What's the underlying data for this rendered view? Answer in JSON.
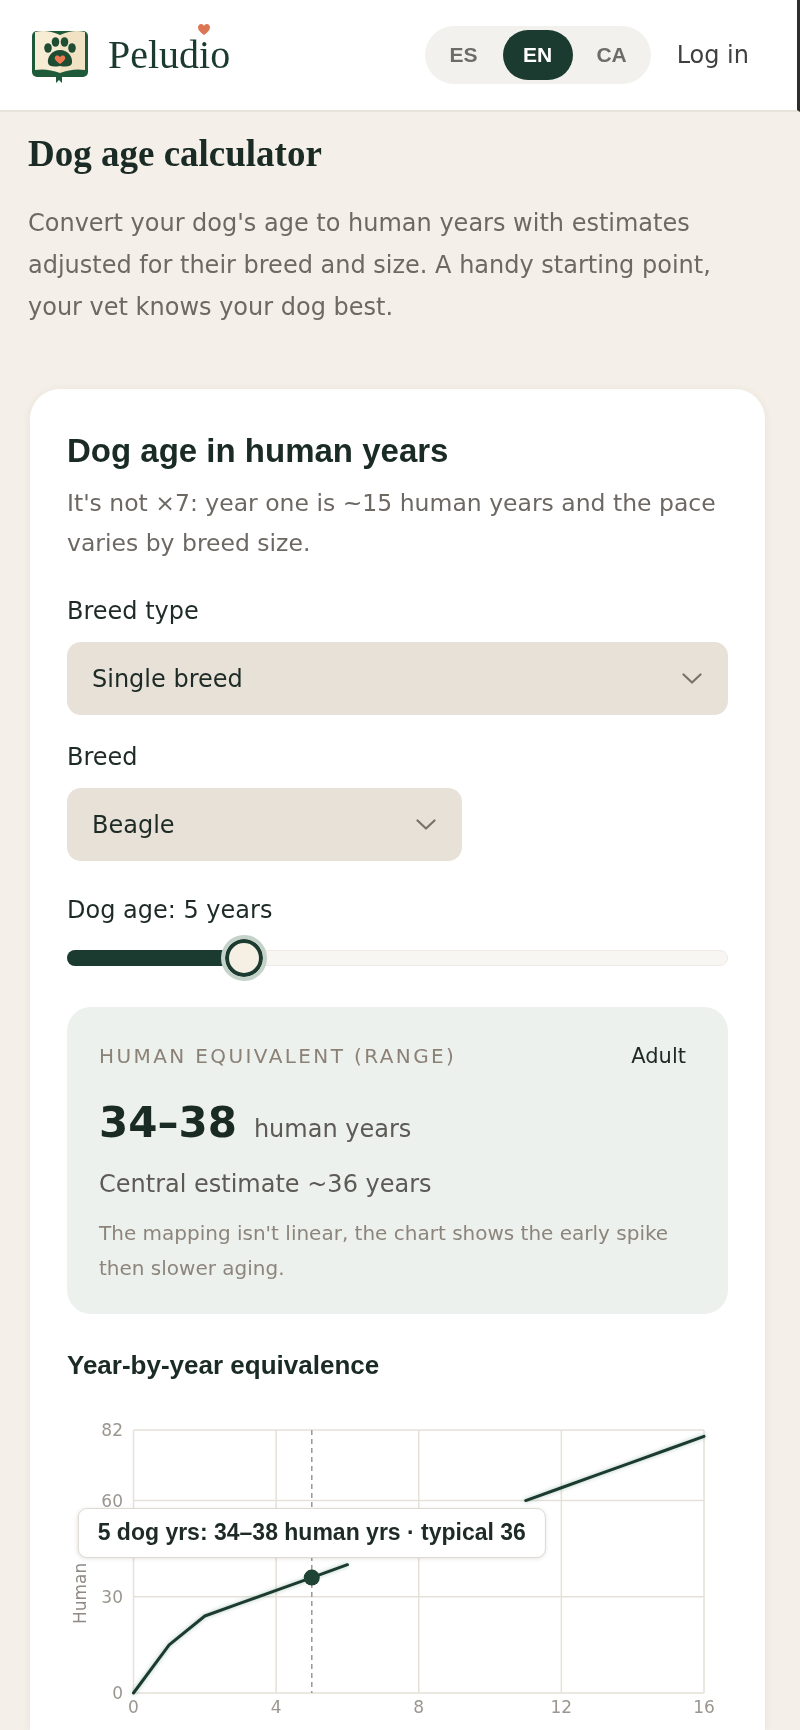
{
  "header": {
    "brand": "Peludio",
    "languages": [
      {
        "label": "ES",
        "selected": false
      },
      {
        "label": "EN",
        "selected": true
      },
      {
        "label": "CA",
        "selected": false
      }
    ],
    "login": "Log in"
  },
  "page": {
    "title": "Dog age calculator",
    "intro": "Convert your dog's age to human years with estimates adjusted for their breed and size. A handy starting point, your vet knows your dog best."
  },
  "calculator": {
    "title": "Dog age in human years",
    "subtitle": "It's not ×7: year one is ~15 human years and the pace varies by breed size.",
    "breed_type": {
      "label": "Breed type",
      "value": "Single breed"
    },
    "breed": {
      "label": "Breed",
      "value": "Beagle"
    },
    "age": {
      "label": "Dog age: 5 years",
      "level": 0.25
    },
    "result": {
      "caption": "HUMAN EQUIVALENT (RANGE)",
      "stage": "Adult",
      "range": "34–38",
      "unit": "human years",
      "central": "Central estimate ~36 years",
      "note": "The mapping isn't linear, the chart shows the early spike then slower aging."
    },
    "chart": {
      "title": "Year-by-year equivalence",
      "chart_data": {
        "type": "line",
        "ylabel": "Human",
        "x": [
          0,
          1,
          2,
          3,
          4,
          5,
          6,
          7,
          8,
          9,
          10,
          11,
          12,
          13,
          14,
          15,
          16
        ],
        "values": [
          0,
          15,
          24,
          28,
          32,
          36,
          40,
          null,
          null,
          null,
          null,
          60,
          64,
          68,
          72,
          76,
          80
        ],
        "xlim": [
          0,
          16
        ],
        "ylim": [
          0,
          82
        ],
        "xticks": [
          0,
          4,
          8,
          12,
          16
        ],
        "yticks": [
          0,
          30,
          60,
          82
        ],
        "grid": true,
        "ref_lines": [
          {
            "axis": "x",
            "value": 5
          }
        ],
        "annotations": [
          "5 dog yrs: 34–38 human yrs · typical 36"
        ]
      }
    }
  }
}
